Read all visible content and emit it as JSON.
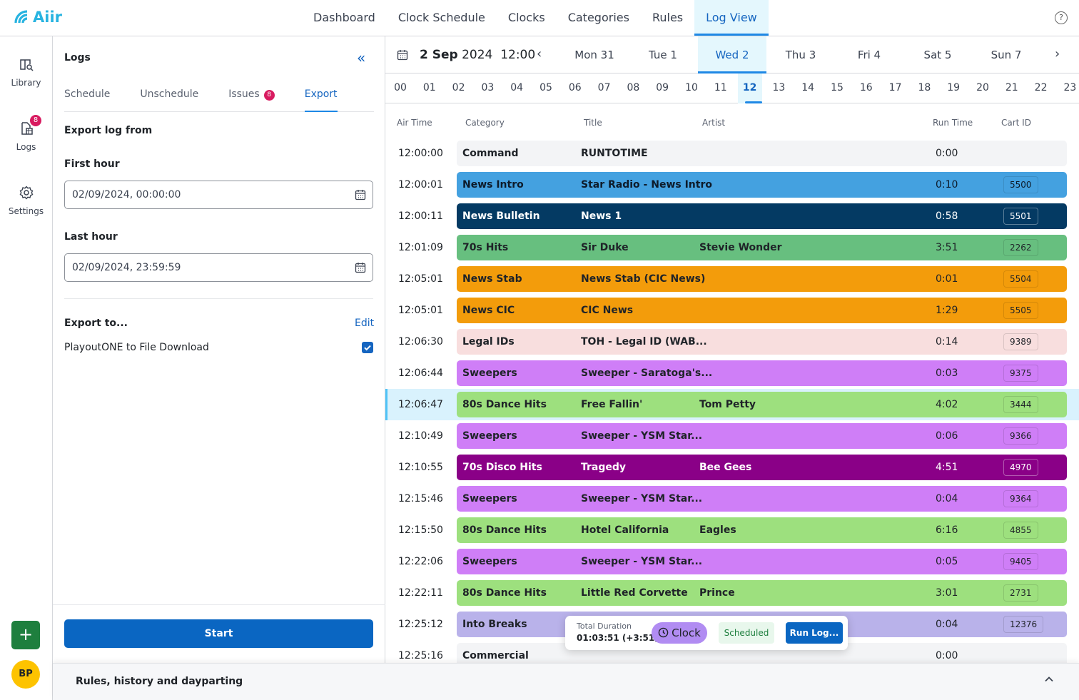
{
  "app": {
    "name": "Aiir"
  },
  "topnav": {
    "items": [
      {
        "label": "Dashboard",
        "active": false
      },
      {
        "label": "Clock Schedule",
        "active": false
      },
      {
        "label": "Clocks",
        "active": false
      },
      {
        "label": "Categories",
        "active": false
      },
      {
        "label": "Rules",
        "active": false
      },
      {
        "label": "Log View",
        "active": true
      }
    ],
    "help_icon": "?"
  },
  "rail": {
    "items": [
      {
        "label": "Library",
        "icon": "library-icon"
      },
      {
        "label": "Logs",
        "icon": "logs-icon",
        "badge": "8"
      },
      {
        "label": "Settings",
        "icon": "gear-icon"
      }
    ],
    "add_label": "+",
    "avatar_initials": "BP"
  },
  "panel": {
    "title": "Logs",
    "collapse_icon": "«",
    "tabs": [
      {
        "label": "Schedule",
        "active": false
      },
      {
        "label": "Unschedule",
        "active": false
      },
      {
        "label": "Issues",
        "active": false,
        "badge": "8"
      },
      {
        "label": "Export",
        "active": true
      }
    ],
    "export_from_label": "Export log from",
    "first_hour_label": "First hour",
    "first_hour_value": "02/09/2024, 00:00:00",
    "last_hour_label": "Last hour",
    "last_hour_value": "02/09/2024, 23:59:59",
    "export_to_label": "Export to...",
    "edit_label": "Edit",
    "destination_label": "PlayoutONE to File Download",
    "destination_checked": true,
    "start_label": "Start"
  },
  "datebar": {
    "date_bold": "2 Sep",
    "year": "2024",
    "time": "12:00",
    "prev_icon": "‹",
    "next_icon": "›",
    "days": [
      {
        "label": "Mon 31",
        "active": false
      },
      {
        "label": "Tue 1",
        "active": false
      },
      {
        "label": "Wed 2",
        "active": true
      },
      {
        "label": "Thu 3",
        "active": false
      },
      {
        "label": "Fri 4",
        "active": false
      },
      {
        "label": "Sat 5",
        "active": false
      },
      {
        "label": "Sun 7",
        "active": false
      }
    ]
  },
  "hours": {
    "items": [
      "00",
      "01",
      "02",
      "03",
      "04",
      "05",
      "06",
      "07",
      "08",
      "09",
      "10",
      "11",
      "12",
      "13",
      "14",
      "15",
      "16",
      "17",
      "18",
      "19",
      "20",
      "21",
      "22",
      "23"
    ],
    "active": "12"
  },
  "table": {
    "columns": [
      "Air Time",
      "Category",
      "Title",
      "Artist",
      "Run Time",
      "Cart ID"
    ],
    "rows": [
      {
        "air": "12:00:00",
        "category": "Command",
        "title": "RUNTOTIME",
        "artist": "",
        "run": "0:00",
        "cart": "",
        "color": "#f3f4f6",
        "text": "#1f2328"
      },
      {
        "air": "12:00:01",
        "category": "News Intro",
        "title": "Star Radio - News Intro",
        "artist": "",
        "run": "0:10",
        "cart": "5500",
        "color": "#44a1e0",
        "text": "#0d1b2a"
      },
      {
        "air": "12:00:11",
        "category": "News Bulletin",
        "title": "News 1",
        "artist": "",
        "run": "0:58",
        "cart": "5501",
        "color": "#043a63",
        "text": "#ffffff"
      },
      {
        "air": "12:01:09",
        "category": "70s Hits",
        "title": "Sir Duke",
        "artist": "Stevie Wonder",
        "run": "3:51",
        "cart": "2262",
        "color": "#67bf7f",
        "text": "#1f2328"
      },
      {
        "air": "12:05:01",
        "category": "News Stab",
        "title": "News Stab (CIC News)",
        "artist": "",
        "run": "0:01",
        "cart": "5504",
        "color": "#f39c0b",
        "text": "#1f2328"
      },
      {
        "air": "12:05:01",
        "category": "News CIC",
        "title": "CIC News",
        "artist": "",
        "run": "1:29",
        "cart": "5505",
        "color": "#f39c0b",
        "text": "#1f2328"
      },
      {
        "air": "12:06:30",
        "category": "Legal IDs",
        "title": "TOH - Legal ID (WAB...",
        "artist": "",
        "run": "0:14",
        "cart": "9389",
        "color": "#f8dede",
        "text": "#1f2328"
      },
      {
        "air": "12:06:44",
        "category": "Sweepers",
        "title": "Sweeper - Saratoga's...",
        "artist": "",
        "run": "0:03",
        "cart": "9375",
        "color": "#cf7ef7",
        "text": "#1f2328"
      },
      {
        "air": "12:06:47",
        "category": "80s Dance Hits",
        "title": "Free Fallin'",
        "artist": "Tom Petty",
        "run": "4:02",
        "cart": "3444",
        "color": "#9de07e",
        "text": "#1f2328",
        "selected": true
      },
      {
        "air": "12:10:49",
        "category": "Sweepers",
        "title": "Sweeper - YSM Star...",
        "artist": "",
        "run": "0:06",
        "cart": "9366",
        "color": "#cf7ef7",
        "text": "#1f2328"
      },
      {
        "air": "12:10:55",
        "category": "70s Disco Hits",
        "title": "Tragedy",
        "artist": "Bee Gees",
        "run": "4:51",
        "cart": "4970",
        "color": "#8a0087",
        "text": "#ffffff"
      },
      {
        "air": "12:15:46",
        "category": "Sweepers",
        "title": "Sweeper - YSM Star...",
        "artist": "",
        "run": "0:04",
        "cart": "9364",
        "color": "#cf7ef7",
        "text": "#1f2328"
      },
      {
        "air": "12:15:50",
        "category": "80s Dance Hits",
        "title": "Hotel California",
        "artist": "Eagles",
        "run": "6:16",
        "cart": "4855",
        "color": "#9de07e",
        "text": "#1f2328"
      },
      {
        "air": "12:22:06",
        "category": "Sweepers",
        "title": "Sweeper - YSM Star...",
        "artist": "",
        "run": "0:05",
        "cart": "9405",
        "color": "#cf7ef7",
        "text": "#1f2328"
      },
      {
        "air": "12:22:11",
        "category": "80s Dance Hits",
        "title": "Little Red Corvette",
        "artist": "Prince",
        "run": "3:01",
        "cart": "2731",
        "color": "#9de07e",
        "text": "#1f2328"
      },
      {
        "air": "12:25:12",
        "category": "Into Breaks",
        "title": "",
        "artist": "",
        "run": "0:04",
        "cart": "12376",
        "color": "#b9b2ea",
        "text": "#1f2328"
      },
      {
        "air": "12:25:16",
        "category": "Commercial",
        "title": "",
        "artist": "",
        "run": "0:00",
        "cart": "",
        "color": "#f3f4f6",
        "text": "#1f2328"
      }
    ]
  },
  "popover": {
    "total_label": "Total Duration",
    "total_value": "01:03:51 (+3:51)",
    "clock_label": "Clock",
    "status_label": "Scheduled",
    "run_log_label": "Run Log..."
  },
  "drawer": {
    "title": "Rules, history and dayparting",
    "chevron_icon": "^"
  }
}
